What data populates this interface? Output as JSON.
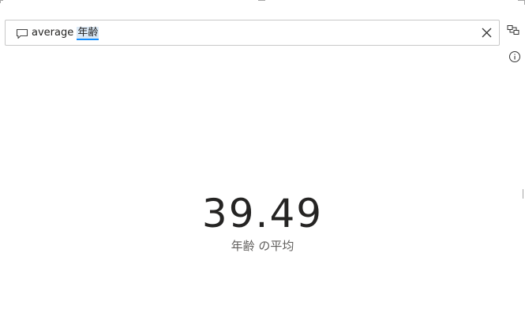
{
  "qa": {
    "query_prefix": "average",
    "query_term": "年齢",
    "icons": {
      "prompt": "speech-bubble-icon",
      "clear": "close-icon",
      "convert": "convert-to-visual-icon",
      "info": "info-icon"
    }
  },
  "result": {
    "value": "39.49",
    "label": "年齢 の平均"
  },
  "colors": {
    "term_highlight": "#dbe9f6",
    "term_underline": "#118dff",
    "value_text": "#252423",
    "label_text": "#605e5c"
  }
}
